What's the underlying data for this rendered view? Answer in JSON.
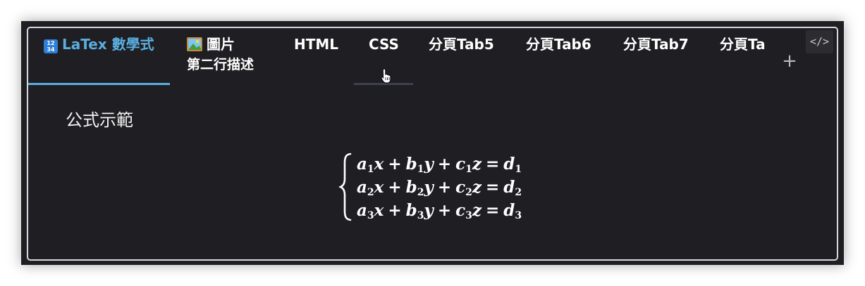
{
  "tabs": [
    {
      "icon": "1234-keycap-icon",
      "icon_text": "12\n34",
      "label": "LaTex 數學式",
      "active": true
    },
    {
      "icon": "framed-picture-icon",
      "label": "圖片",
      "subtitle": "第二行描述"
    },
    {
      "label": "HTML"
    },
    {
      "label": "CSS"
    },
    {
      "label": "分頁Tab5"
    },
    {
      "label": "分頁Tab6"
    },
    {
      "label": "分頁Tab7"
    },
    {
      "label": "分頁Ta"
    }
  ],
  "toolbar": {
    "add_label": "+",
    "code_label": "</>"
  },
  "content": {
    "heading": "公式示範",
    "equations": [
      {
        "a": "a",
        "b": "b",
        "c": "c",
        "d": "d",
        "n": "1"
      },
      {
        "a": "a",
        "b": "b",
        "c": "c",
        "d": "d",
        "n": "2"
      },
      {
        "a": "a",
        "b": "b",
        "c": "c",
        "d": "d",
        "n": "3"
      }
    ]
  },
  "colors": {
    "accent": "#5aaedf",
    "background": "#1f1e22",
    "text": "#ffffff"
  }
}
